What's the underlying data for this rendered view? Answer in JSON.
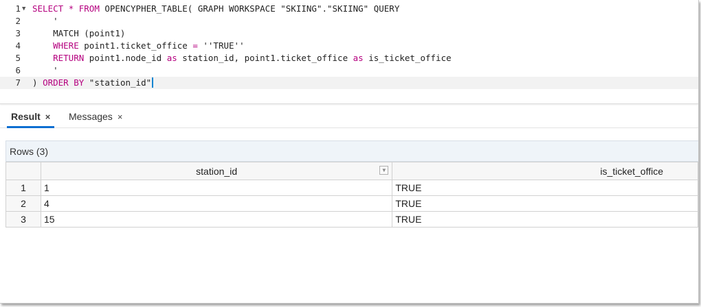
{
  "editor": {
    "lines": [
      {
        "num": "1",
        "fold": "▼",
        "parts": [
          [
            "kw",
            "SELECT"
          ],
          [
            "t",
            " "
          ],
          [
            "kw",
            "*"
          ],
          [
            "t",
            " "
          ],
          [
            "kw",
            "FROM"
          ],
          [
            "t",
            " OPENCYPHER_TABLE( GRAPH WORKSPACE \"SKIING\".\"SKIING\" QUERY"
          ]
        ]
      },
      {
        "num": "2",
        "fold": "",
        "parts": [
          [
            "t",
            "    '"
          ]
        ]
      },
      {
        "num": "3",
        "fold": "",
        "parts": [
          [
            "t",
            "    MATCH (point1)"
          ]
        ]
      },
      {
        "num": "4",
        "fold": "",
        "parts": [
          [
            "t",
            "    "
          ],
          [
            "kw",
            "WHERE"
          ],
          [
            "t",
            " point1.ticket_office "
          ],
          [
            "kw",
            "="
          ],
          [
            "t",
            " ''TRUE''"
          ]
        ]
      },
      {
        "num": "5",
        "fold": "",
        "parts": [
          [
            "t",
            "    "
          ],
          [
            "kw",
            "RETURN"
          ],
          [
            "t",
            " point1.node_id "
          ],
          [
            "kw",
            "as"
          ],
          [
            "t",
            " station_id, point1.ticket_office "
          ],
          [
            "kw",
            "as"
          ],
          [
            "t",
            " is_ticket_office"
          ]
        ]
      },
      {
        "num": "6",
        "fold": "",
        "parts": [
          [
            "t",
            "    '"
          ]
        ]
      },
      {
        "num": "7",
        "fold": "",
        "parts": [
          [
            "t",
            ") "
          ],
          [
            "kw",
            "ORDER BY"
          ],
          [
            "t",
            " \"station_id\""
          ]
        ]
      }
    ],
    "active_line": 7
  },
  "tabs": [
    {
      "label": "Result",
      "close": "×",
      "active": true
    },
    {
      "label": "Messages",
      "close": "×",
      "active": false
    }
  ],
  "result": {
    "rows_label": "Rows (3)",
    "columns": [
      "station_id",
      "is_ticket_office"
    ],
    "filter_icon": "▼",
    "rows": [
      {
        "idx": "1",
        "station_id": "1",
        "is_ticket_office": "TRUE"
      },
      {
        "idx": "2",
        "station_id": "4",
        "is_ticket_office": "TRUE"
      },
      {
        "idx": "3",
        "station_id": "15",
        "is_ticket_office": "TRUE"
      }
    ]
  }
}
